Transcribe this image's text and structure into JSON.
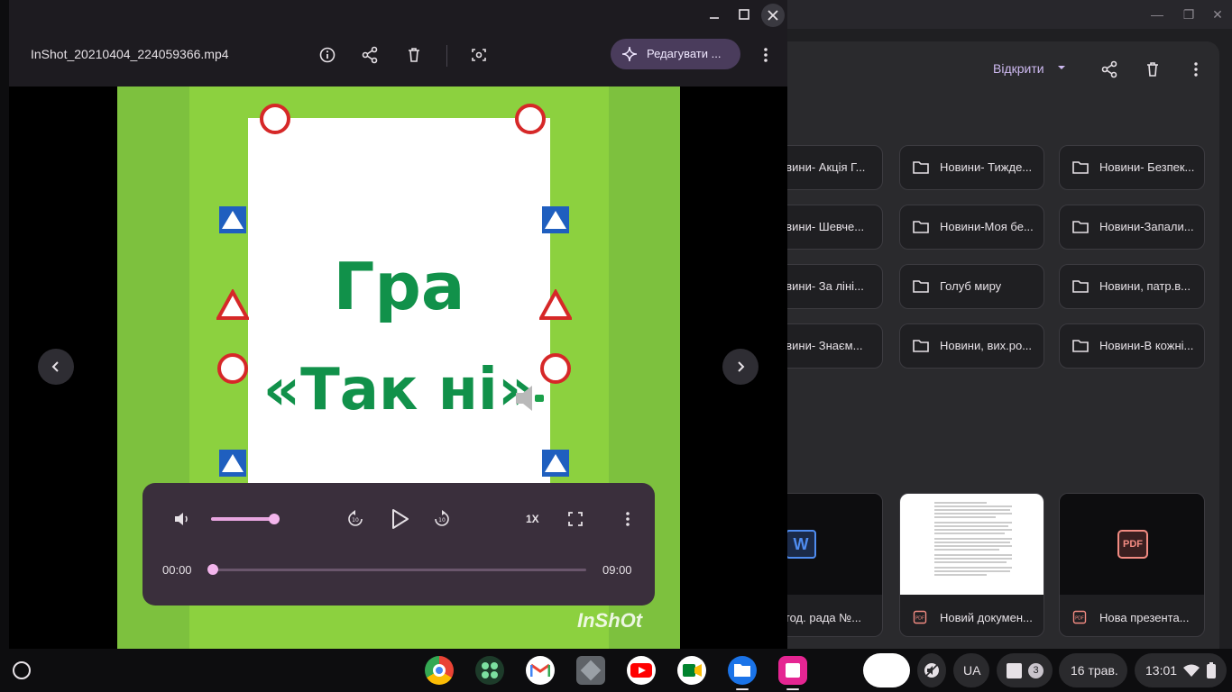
{
  "player": {
    "file_name": "InShot_20210404_224059366.mp4",
    "edit_label": "Редагувати ...",
    "video": {
      "title_line1": "Гра",
      "title_line2": "«Так   ні»",
      "watermark": "InShOt"
    },
    "controls": {
      "speed": "1X",
      "time_current": "00:00",
      "time_total": "09:00",
      "volume_level": 1.0,
      "progress": 0.0
    }
  },
  "files": {
    "open_with_label": "Відкрити",
    "folders": [
      [
        "овини- Акція Г...",
        "Новини- Тижде...",
        "Новини- Безпек..."
      ],
      [
        "овини- Шевче...",
        "Новини-Моя бе...",
        "Новини-Запали..."
      ],
      [
        "овини- За ліні...",
        "Голуб миру",
        "Новини, патр.в..."
      ],
      [
        "овини- Знаєм...",
        "Новини, вих.ро...",
        "Новини-В кожні..."
      ]
    ],
    "files": [
      {
        "label": "етод. рада №...",
        "type": "word"
      },
      {
        "label": "Новий докумен...",
        "type": "pdf"
      },
      {
        "label": "Нова презента...",
        "type": "pdf"
      }
    ],
    "word_badge": "W",
    "pdf_badge": "PDF"
  },
  "shelf": {
    "apps": [
      "chrome-icon",
      "play-store-icon",
      "gmail-icon",
      "app-icon",
      "youtube-icon",
      "meet-icon",
      "files-icon",
      "jamboard-icon"
    ],
    "language": "UA",
    "notification_count": "3",
    "date": "16 трав.",
    "time": "13:01"
  },
  "colors": {
    "accent": "#cdb9f0",
    "seek_knob": "#f3b5ec",
    "video_green": "#11914a"
  }
}
